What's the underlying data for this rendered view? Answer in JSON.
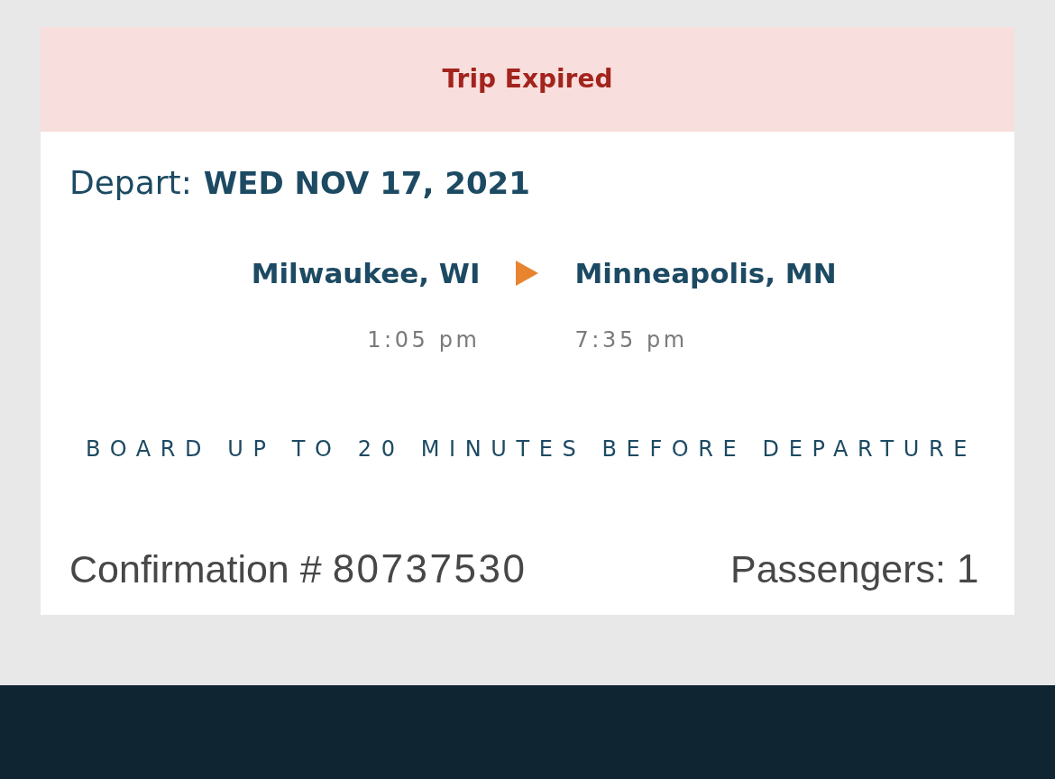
{
  "banner": {
    "status": "Trip Expired"
  },
  "departure": {
    "label": "Depart:",
    "date": "WED NOV 17, 2021"
  },
  "route": {
    "origin": {
      "city": "Milwaukee, WI",
      "time": "1:05 pm"
    },
    "destination": {
      "city": "Minneapolis, MN",
      "time": "7:35 pm"
    }
  },
  "notice": "BOARD UP TO 20 MINUTES BEFORE DEPARTURE",
  "summary": {
    "confirmation_label": "Confirmation #",
    "confirmation_number": "80737530",
    "passengers_label": "Passengers:",
    "passengers_count": "1"
  }
}
